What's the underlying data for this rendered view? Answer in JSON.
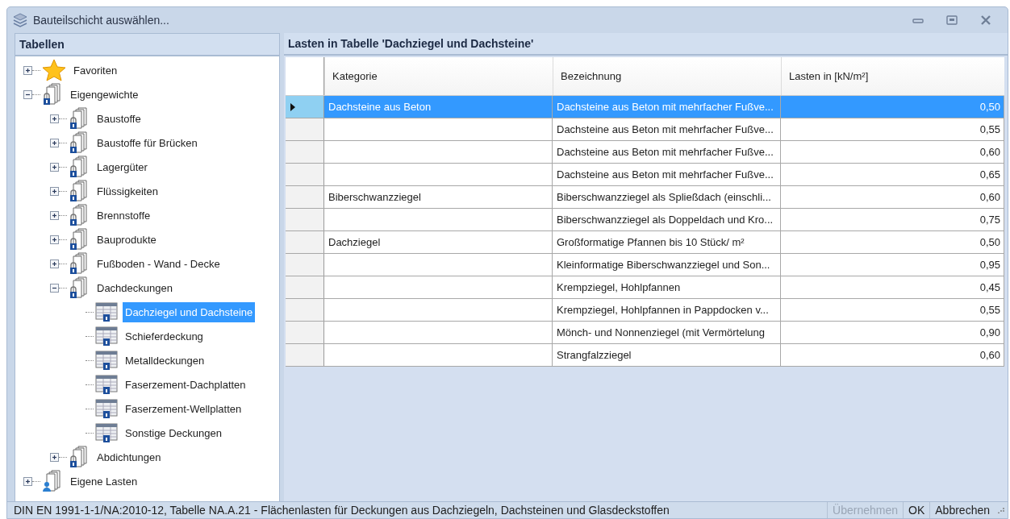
{
  "window": {
    "title": "Bauteilschicht auswählen..."
  },
  "tree_panel": {
    "title": "Tabellen"
  },
  "tree": [
    {
      "label": "Favoriten",
      "kind": "star",
      "expanded": false
    },
    {
      "label": "Eigengewichte",
      "kind": "folder",
      "expanded": true,
      "children": [
        {
          "label": "Baustoffe",
          "kind": "folder",
          "expanded": false
        },
        {
          "label": "Baustoffe für Brücken",
          "kind": "folder",
          "expanded": false
        },
        {
          "label": "Lagergüter",
          "kind": "folder",
          "expanded": false
        },
        {
          "label": "Flüssigkeiten",
          "kind": "folder",
          "expanded": false
        },
        {
          "label": "Brennstoffe",
          "kind": "folder",
          "expanded": false
        },
        {
          "label": "Bauprodukte",
          "kind": "folder",
          "expanded": false
        },
        {
          "label": "Fußboden - Wand - Decke",
          "kind": "folder",
          "expanded": false
        },
        {
          "label": "Dachdeckungen",
          "kind": "folder",
          "expanded": true,
          "children": [
            {
              "label": "Dachziegel und Dachsteine",
              "kind": "table",
              "selected": true
            },
            {
              "label": "Schieferdeckung",
              "kind": "table",
              "selected": false
            },
            {
              "label": "Metalldeckungen",
              "kind": "table",
              "selected": false
            },
            {
              "label": "Faserzement-Dachplatten",
              "kind": "table",
              "selected": false
            },
            {
              "label": "Faserzement-Wellplatten",
              "kind": "table",
              "selected": false
            },
            {
              "label": "Sonstige Deckungen",
              "kind": "table",
              "selected": false
            }
          ]
        },
        {
          "label": "Abdichtungen",
          "kind": "folder",
          "expanded": false
        }
      ]
    },
    {
      "label": "Eigene Lasten",
      "kind": "user",
      "expanded": false
    }
  ],
  "table_panel": {
    "title": "Lasten in Tabelle 'Dachziegel und Dachsteine'"
  },
  "table": {
    "columns": [
      "Kategorie",
      "Bezeichnung",
      "Lasten in [kN/m²]"
    ],
    "rows": [
      {
        "selected": true,
        "cells": [
          "Dachsteine aus Beton",
          "Dachsteine aus Beton mit mehrfacher Fußve...",
          "0,50"
        ]
      },
      {
        "selected": false,
        "cells": [
          "",
          "Dachsteine aus Beton mit mehrfacher Fußve...",
          "0,55"
        ]
      },
      {
        "selected": false,
        "cells": [
          "",
          "Dachsteine aus Beton mit mehrfacher Fußve...",
          "0,60"
        ]
      },
      {
        "selected": false,
        "cells": [
          "",
          "Dachsteine aus Beton mit mehrfacher Fußve...",
          "0,65"
        ]
      },
      {
        "selected": false,
        "cells": [
          "Biberschwanzziegel",
          "Biberschwanzziegel als Spließdach (einschli...",
          "0,60"
        ]
      },
      {
        "selected": false,
        "cells": [
          "",
          "Biberschwanzziegel als Doppeldach und Kro...",
          "0,75"
        ]
      },
      {
        "selected": false,
        "cells": [
          "Dachziegel",
          "Großformatige Pfannen bis 10 Stück/ m²",
          "0,50"
        ]
      },
      {
        "selected": false,
        "cells": [
          "",
          "Kleinformatige Biberschwanzziegel und Son...",
          "0,95"
        ]
      },
      {
        "selected": false,
        "cells": [
          "",
          "Krempziegel, Hohlpfannen",
          "0,45"
        ]
      },
      {
        "selected": false,
        "cells": [
          "",
          "Krempziegel, Hohlpfannen in Pappdocken v...",
          "0,55"
        ]
      },
      {
        "selected": false,
        "cells": [
          "",
          "Mönch- und Nonnenziegel (mit Vermörtelung",
          "0,90"
        ]
      },
      {
        "selected": false,
        "cells": [
          "",
          "Strangfalzziegel",
          "0,60"
        ]
      }
    ]
  },
  "status_bar": {
    "text": "DIN EN 1991-1-1/NA:2010-12, Tabelle NA.A.21 - Flächenlasten für Deckungen aus Dachziegeln, Dachsteinen und Glasdeckstoffen",
    "buttons": [
      {
        "label": "Übernehmen",
        "disabled": true
      },
      {
        "label": "OK",
        "disabled": false
      },
      {
        "label": "Abbrechen",
        "disabled": false
      }
    ]
  }
}
